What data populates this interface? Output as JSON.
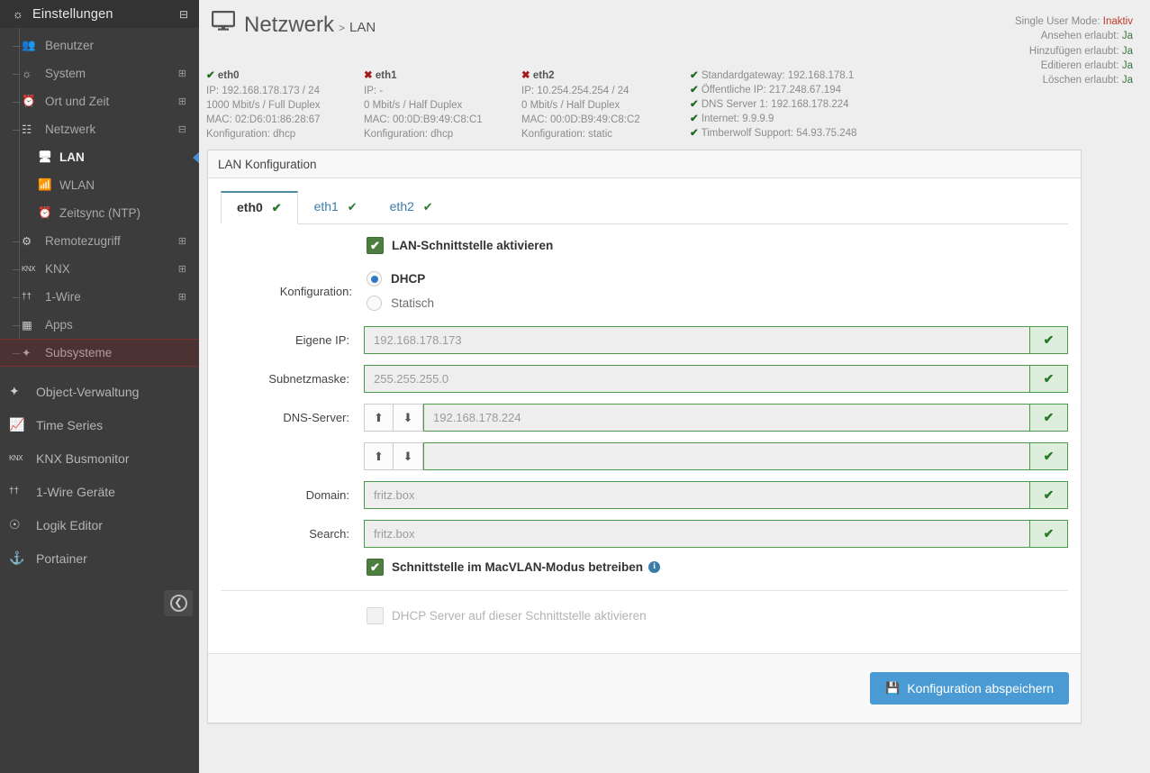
{
  "sidebar": {
    "header": {
      "title": "Einstellungen",
      "icon": "dashboard-icon",
      "toggle": "collapse-icon"
    },
    "tree": [
      {
        "label": "Benutzer",
        "icon": "users-icon",
        "expander": ""
      },
      {
        "label": "System",
        "icon": "dashboard-icon",
        "expander": "⊞"
      },
      {
        "label": "Ort und Zeit",
        "icon": "clock-icon",
        "expander": "⊞"
      },
      {
        "label": "Netzwerk",
        "icon": "sitemap-icon",
        "expander": "⊟"
      }
    ],
    "sub": [
      {
        "label": "LAN",
        "icon": "monitor-icon",
        "active": true
      },
      {
        "label": "WLAN",
        "icon": "wifi-icon",
        "active": false
      },
      {
        "label": "Zeitsync (NTP)",
        "icon": "clock-icon",
        "active": false
      }
    ],
    "tree2": [
      {
        "label": "Remotezugriff",
        "icon": "gears-icon",
        "expander": "⊞"
      },
      {
        "label": "KNX",
        "icon": "knx-icon",
        "expander": "⊞"
      },
      {
        "label": "1-Wire",
        "icon": "wire-icon",
        "expander": "⊞"
      },
      {
        "label": "Apps",
        "icon": "grid-icon",
        "expander": ""
      }
    ],
    "danger": {
      "label": "Subsysteme",
      "icon": "wand-icon"
    },
    "flat": [
      {
        "label": "Object-Verwaltung",
        "icon": "wand-icon"
      },
      {
        "label": "Time Series",
        "icon": "chart-line-icon"
      },
      {
        "label": "KNX Busmonitor",
        "icon": "knx-icon"
      },
      {
        "label": "1-Wire Geräte",
        "icon": "wire-icon"
      },
      {
        "label": "Logik Editor",
        "icon": "brain-icon"
      },
      {
        "label": "Portainer",
        "icon": "portainer-icon"
      }
    ],
    "collapse_button": "collapse-sidebar-icon"
  },
  "header": {
    "icon": "monitor-icon",
    "title": "Netzwerk",
    "separator": ">",
    "crumb": "LAN"
  },
  "usermode": {
    "rows": [
      {
        "label": "Single User Mode:",
        "value": "Inaktiv",
        "state": "no"
      },
      {
        "label": "Ansehen erlaubt:",
        "value": "Ja",
        "state": "yes"
      },
      {
        "label": "Hinzufügen erlaubt:",
        "value": "Ja",
        "state": "yes"
      },
      {
        "label": "Editieren erlaubt:",
        "value": "Ja",
        "state": "yes"
      },
      {
        "label": "Löschen erlaubt:",
        "value": "Ja",
        "state": "yes"
      }
    ]
  },
  "status": {
    "interfaces": [
      {
        "name": "eth0",
        "ok": true,
        "mark": "✔",
        "lines": [
          "IP: 192.168.178.173 / 24",
          "1000 Mbit/s / Full Duplex",
          "MAC: 02:D6:01:86:28:67",
          "Konfiguration: dhcp"
        ]
      },
      {
        "name": "eth1",
        "ok": false,
        "mark": "✖",
        "lines": [
          "IP: -",
          "0 Mbit/s / Half Duplex",
          "MAC: 00:0D:B9:49:C8:C1",
          "Konfiguration: dhcp"
        ]
      },
      {
        "name": "eth2",
        "ok": false,
        "mark": "✖",
        "lines": [
          "IP: 10.254.254.254 / 24",
          "0 Mbit/s / Half Duplex",
          "MAC: 00:0D:B9:49:C8:C2",
          "Konfiguration: static"
        ]
      }
    ],
    "network": [
      "Standardgateway: 192.168.178.1",
      "Öffentliche IP: 217.248.67.194",
      "DNS Server 1: 192.168.178.224",
      "Internet: 9.9.9.9",
      "Timberwolf Support: 54.93.75.248"
    ]
  },
  "panel": {
    "title": "LAN Konfiguration",
    "tabs": [
      {
        "label": "eth0",
        "check": "✔",
        "active": true
      },
      {
        "label": "eth1",
        "check": "✔",
        "active": false
      },
      {
        "label": "eth2",
        "check": "✔",
        "active": false
      }
    ],
    "enable_checkbox": {
      "label": "LAN-Schnittstelle aktivieren",
      "checked": true
    },
    "config": {
      "label": "Konfiguration:",
      "options": [
        {
          "label": "DHCP",
          "selected": true
        },
        {
          "label": "Statisch",
          "selected": false
        }
      ]
    },
    "fields": [
      {
        "label": "Eigene IP:",
        "value": "192.168.178.173",
        "valid": "✔",
        "arrows": false
      },
      {
        "label": "Subnetzmaske:",
        "value": "255.255.255.0",
        "valid": "✔",
        "arrows": false
      },
      {
        "label": "DNS-Server:",
        "value": "192.168.178.224",
        "valid": "✔",
        "arrows": true
      },
      {
        "label": "",
        "value": "",
        "valid": "✔",
        "arrows": true
      },
      {
        "label": "Domain:",
        "value": "fritz.box",
        "valid": "✔",
        "arrows": false
      },
      {
        "label": "Search:",
        "value": "fritz.box",
        "valid": "✔",
        "arrows": false
      }
    ],
    "arrow_up": "⬆",
    "arrow_down": "⬇",
    "macvlan_checkbox": {
      "label": "Schnittstelle im MacVLAN-Modus betreiben",
      "checked": true,
      "info": "i"
    },
    "dhcp_server_checkbox": {
      "label": "DHCP Server auf dieser Schnittstelle aktivieren",
      "checked": false
    },
    "save_button": {
      "label": "Konfiguration abspeichern",
      "icon": "💾"
    }
  },
  "colors": {
    "sidebar_bg": "#3c3c3c",
    "accent_blue": "#4a9bd4",
    "ok_green": "#1e6b1e",
    "bad_red": "#a21b1b",
    "tab_active_border": "#4f8ba3"
  }
}
